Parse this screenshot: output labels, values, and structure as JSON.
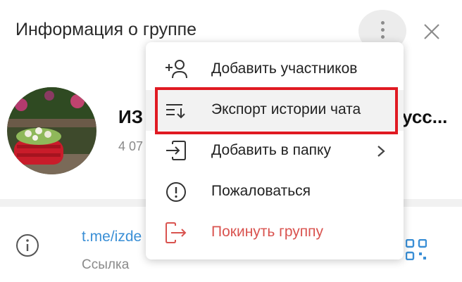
{
  "header": {
    "title": "Информация о группе"
  },
  "group": {
    "name_start": "ИЗ",
    "name_end": "усс...",
    "members_partial": "4 07"
  },
  "link": {
    "url_partial": "t.me/izde",
    "caption": "Ссылка"
  },
  "menu": {
    "items": [
      {
        "label": "Добавить участников",
        "icon": "add-user-icon"
      },
      {
        "label": "Экспорт истории чата",
        "icon": "export-history-icon",
        "highlighted": true
      },
      {
        "label": "Добавить в папку",
        "icon": "folder-add-icon",
        "submenu": true
      },
      {
        "label": "Пожаловаться",
        "icon": "report-icon"
      },
      {
        "label": "Покинуть группу",
        "icon": "leave-icon",
        "danger": true
      }
    ]
  },
  "colors": {
    "accent": "#3a8fd6",
    "danger": "#d9534f",
    "highlight_frame": "#e01a22"
  }
}
